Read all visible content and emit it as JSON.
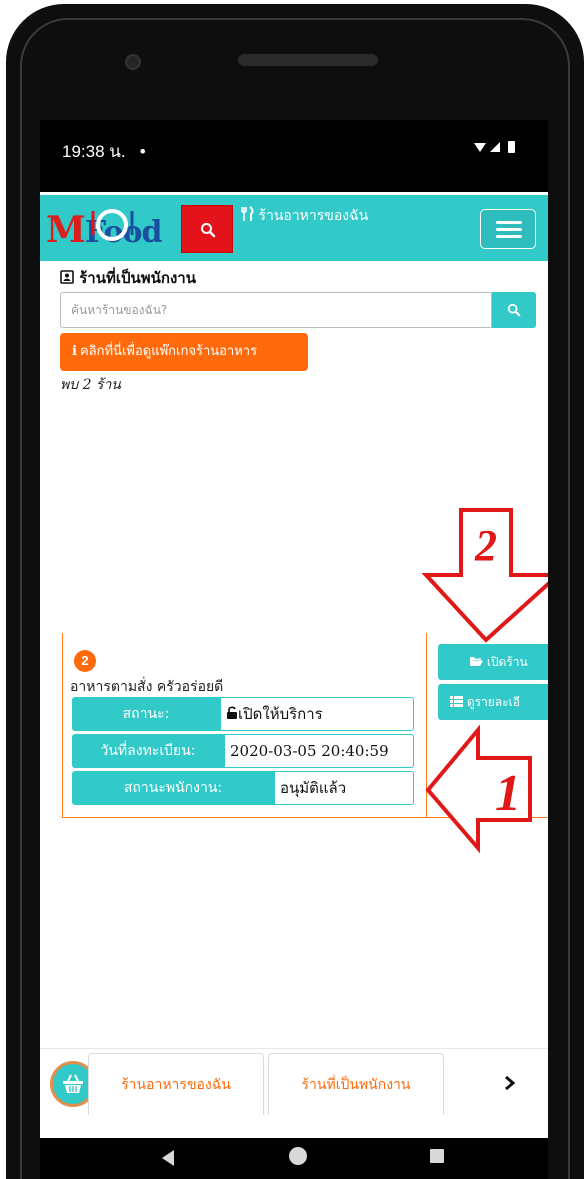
{
  "status_bar": {
    "time": "19:38 น.",
    "dot": "•"
  },
  "navbar": {
    "logo_m": "M",
    "logo_food": "Food",
    "search_icon": "search-icon",
    "title_icon": "utensils-icon",
    "title": "ร้านอาหารของฉัน",
    "menu_icon": "hamburger-icon"
  },
  "page": {
    "title_icon": "id-card-icon",
    "title": "ร้านที่เป็นพนักงาน",
    "search_placeholder": "ค้นหาร้านของฉัน?",
    "package_button_icon": "i",
    "package_button": "คลิกที่นี่เพื่อดูแพ๊กเกจร้านอาหาร",
    "found_text": "พบ 2 ร้าน"
  },
  "shop": {
    "badge": "2",
    "name": "อาหารตามสั่ง ครัวอร่อยดี",
    "rows": [
      {
        "label": "สถานะ:",
        "value": "เปิดให้บริการ",
        "value_icon": "unlock-icon"
      },
      {
        "label": "วันที่ลงทะเบียน:",
        "value": "2020-03-05 20:40:59"
      },
      {
        "label": "สถานะพนักงาน:",
        "value": "อนุมัติแล้ว"
      }
    ],
    "actions": [
      {
        "label": "เปิดร้าน",
        "icon": "folder-open-icon"
      },
      {
        "label": "ดูรายละเอี",
        "icon": "list-icon"
      }
    ]
  },
  "annotations": {
    "arrow1": "1",
    "arrow2": "2",
    "arrow_color": "#e01818"
  },
  "bottom_nav": {
    "basket_icon": "basket-icon",
    "tab1": "ร้านอาหารของฉัน",
    "tab2": "ร้านที่เป็นพนักงาน",
    "next": "›"
  },
  "colors": {
    "teal": "#32c9c9",
    "orange": "#ff6a0c",
    "red": "#e3121b"
  }
}
